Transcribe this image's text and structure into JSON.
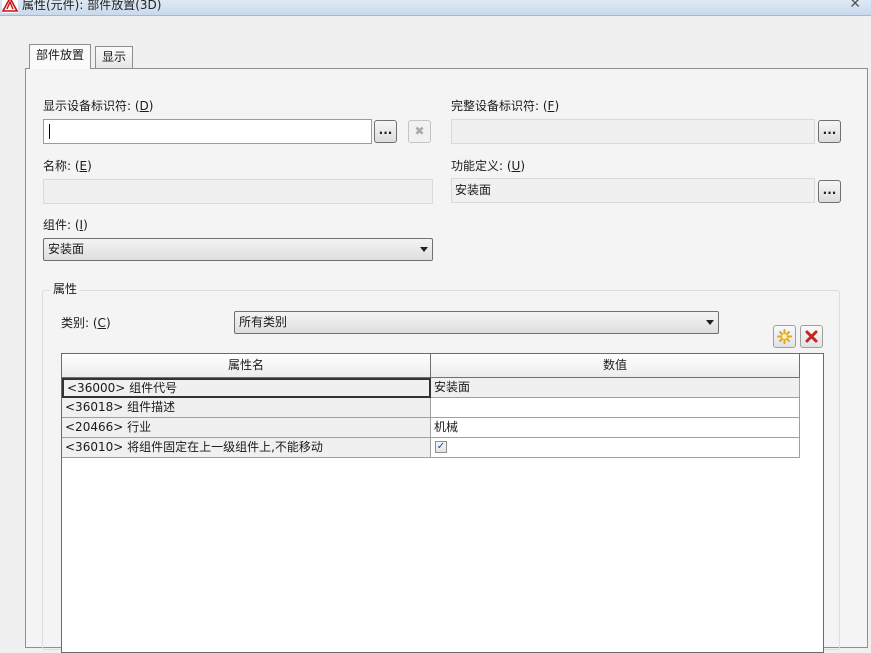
{
  "window": {
    "title": "属性(元件): 部件放置(3D)",
    "close_glyph": "✕"
  },
  "tabs": [
    {
      "label": "部件放置",
      "active": true
    },
    {
      "label": "显示",
      "active": false
    }
  ],
  "fields": {
    "display_id": {
      "label": "显示设备标识符:",
      "accel": "D",
      "value": ""
    },
    "full_id": {
      "label": "完整设备标识符:",
      "accel": "F",
      "value": ""
    },
    "name": {
      "label": "名称:",
      "accel": "E",
      "value": ""
    },
    "function_def": {
      "label": "功能定义:",
      "accel": "U",
      "value": "安装面"
    },
    "component": {
      "label": "组件:",
      "accel": "I",
      "value": "安装面"
    }
  },
  "browse_label": "...",
  "clear_glyph": "✖",
  "properties": {
    "group_title": "属性",
    "category": {
      "label": "类别:",
      "accel": "C",
      "value": "所有类别"
    },
    "columns": [
      "属性名",
      "数值"
    ],
    "rows": [
      {
        "name": "<36000> 组件代号",
        "value": "安装面"
      },
      {
        "name": "<36018> 组件描述",
        "value": ""
      },
      {
        "name": "<20466> 行业",
        "value": "机械"
      },
      {
        "name": "<36010> 将组件固定在上一级组件上,不能移动",
        "checked": true
      }
    ]
  },
  "colors": {
    "new_icon": "#e8a317",
    "delete_icon": "#c0281e"
  }
}
